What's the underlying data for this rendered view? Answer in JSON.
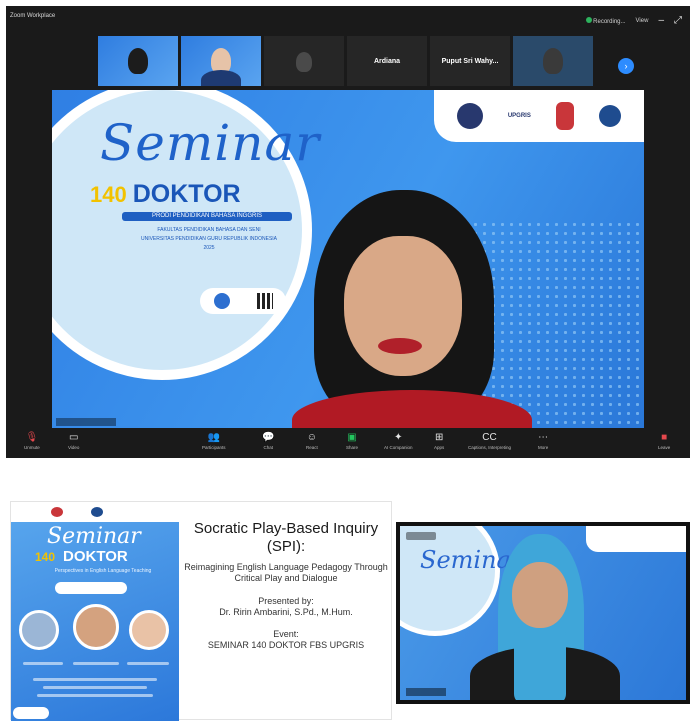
{
  "titlebar": {
    "meeting_label": "Zoom Workplace",
    "recording_label": "Recording...",
    "view_label": "View"
  },
  "thumbnails": [
    {
      "name": "",
      "kind": "slide"
    },
    {
      "name": "",
      "kind": "camera"
    },
    {
      "name": "",
      "kind": "camera-dark"
    },
    {
      "name": "Ardiana",
      "kind": "text"
    },
    {
      "name": "Puput Sri Wahy...",
      "kind": "text"
    },
    {
      "name": "",
      "kind": "camera-dark"
    }
  ],
  "main_slide": {
    "script_title": "Seminar",
    "number": "140",
    "doktor": "DOKTOR",
    "prodi": "PRODI PENDIDIKAN BAHASA INGGRIS",
    "line1": "FAKULTAS PENDIDIKAN BAHASA DAN SENI",
    "line2": "UNIVERSITAS PENDIDIKAN GURU REPUBLIK INDONESIA",
    "line3": "2025",
    "logo_text": "UPGRIS"
  },
  "toolbar": {
    "items": [
      {
        "icon": "mic-icon",
        "label": "Unmute"
      },
      {
        "icon": "video-icon",
        "label": "Video"
      },
      {
        "icon": "participants-icon",
        "label": "Participants"
      },
      {
        "icon": "chat-icon",
        "label": "Chat"
      },
      {
        "icon": "react-icon",
        "label": "React"
      },
      {
        "icon": "share-icon",
        "label": "Share"
      },
      {
        "icon": "ai-companion-icon",
        "label": "AI Companion"
      },
      {
        "icon": "apps-icon",
        "label": "Apps"
      },
      {
        "icon": "captions-icon",
        "label": "Captions, Interpreting"
      },
      {
        "icon": "more-icon",
        "label": "More"
      }
    ],
    "end_label": "Leave"
  },
  "slide_card": {
    "title": "Socratic Play-Based Inquiry (SPI):",
    "subtitle": "Reimagining English Language Pedagogy Through Critical Play and Dialogue",
    "presented_label": "Presented by:",
    "presenter": "Dr. Ririn Ambarini, S.Pd., M.Hum.",
    "event_label": "Event:",
    "event": "SEMINAR 140 DOKTOR FBS UPGRIS",
    "poster_script": "Seminar",
    "poster_number": "140",
    "poster_doktor": "DOKTOR",
    "poster_sub": "Perspectives in English Language Teaching"
  },
  "zoom2": {
    "script_title": "Seminar"
  },
  "colors": {
    "slide_blue": "#2f7fe4",
    "accent_yellow": "#f2c200",
    "speaker_red": "#b11a24",
    "hijab_blue": "#3fa6d9",
    "zoom_dark": "#1a1a1a"
  }
}
